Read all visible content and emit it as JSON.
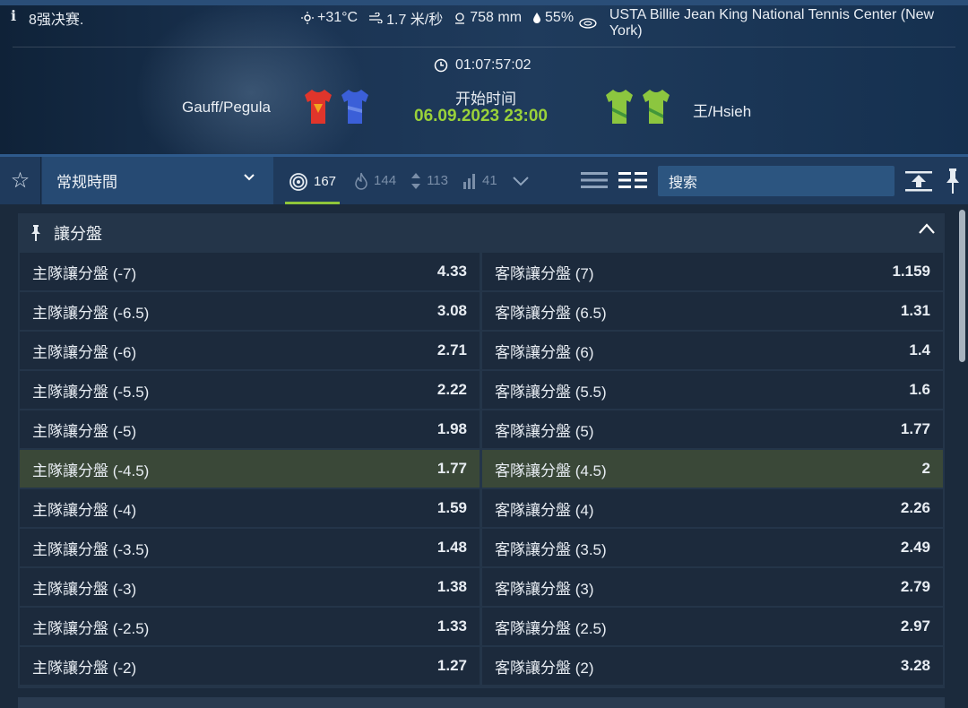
{
  "header": {
    "round": "8强决赛.",
    "weather": {
      "temperature": "+31°C",
      "wind": "1.7 米/秒",
      "pressure": "758 mm",
      "humidity": "55%"
    },
    "venue": "USTA Billie Jean King National Tennis Center (New York)",
    "countdown": "01:07:57:02",
    "start_label": "开始时间",
    "start_time": "06.09.2023 23:00",
    "home_team": "Gauff/Pegula",
    "away_team": "王/Hsieh",
    "colors": {
      "accent_green": "#9ad23a",
      "home_shirt_1": "#e0352b",
      "home_shirt_2": "#3b5fd8",
      "away_shirt": "#8cc63f"
    }
  },
  "toolbar": {
    "period_select": "常规時間",
    "stats": [
      {
        "icon": "target-icon",
        "value": "167"
      },
      {
        "icon": "fire-icon",
        "value": "144"
      },
      {
        "icon": "up-down-icon",
        "value": "113"
      },
      {
        "icon": "bars-icon",
        "value": "41"
      }
    ],
    "search_placeholder": "搜索"
  },
  "market": {
    "title": "讓分盤",
    "rows": [
      {
        "home_label": "主隊讓分盤 (-7)",
        "home_odds": "4.33",
        "away_label": "客隊讓分盤 (7)",
        "away_odds": "1.159"
      },
      {
        "home_label": "主隊讓分盤 (-6.5)",
        "home_odds": "3.08",
        "away_label": "客隊讓分盤 (6.5)",
        "away_odds": "1.31"
      },
      {
        "home_label": "主隊讓分盤 (-6)",
        "home_odds": "2.71",
        "away_label": "客隊讓分盤 (6)",
        "away_odds": "1.4"
      },
      {
        "home_label": "主隊讓分盤 (-5.5)",
        "home_odds": "2.22",
        "away_label": "客隊讓分盤 (5.5)",
        "away_odds": "1.6"
      },
      {
        "home_label": "主隊讓分盤 (-5)",
        "home_odds": "1.98",
        "away_label": "客隊讓分盤 (5)",
        "away_odds": "1.77"
      },
      {
        "home_label": "主隊讓分盤 (-4.5)",
        "home_odds": "1.77",
        "away_label": "客隊讓分盤 (4.5)",
        "away_odds": "2"
      },
      {
        "home_label": "主隊讓分盤 (-4)",
        "home_odds": "1.59",
        "away_label": "客隊讓分盤 (4)",
        "away_odds": "2.26"
      },
      {
        "home_label": "主隊讓分盤 (-3.5)",
        "home_odds": "1.48",
        "away_label": "客隊讓分盤 (3.5)",
        "away_odds": "2.49"
      },
      {
        "home_label": "主隊讓分盤 (-3)",
        "home_odds": "1.38",
        "away_label": "客隊讓分盤 (3)",
        "away_odds": "2.79"
      },
      {
        "home_label": "主隊讓分盤 (-2.5)",
        "home_odds": "1.33",
        "away_label": "客隊讓分盤 (2.5)",
        "away_odds": "2.97"
      },
      {
        "home_label": "主隊讓分盤 (-2)",
        "home_odds": "1.27",
        "away_label": "客隊讓分盤 (2)",
        "away_odds": "3.28"
      }
    ]
  }
}
